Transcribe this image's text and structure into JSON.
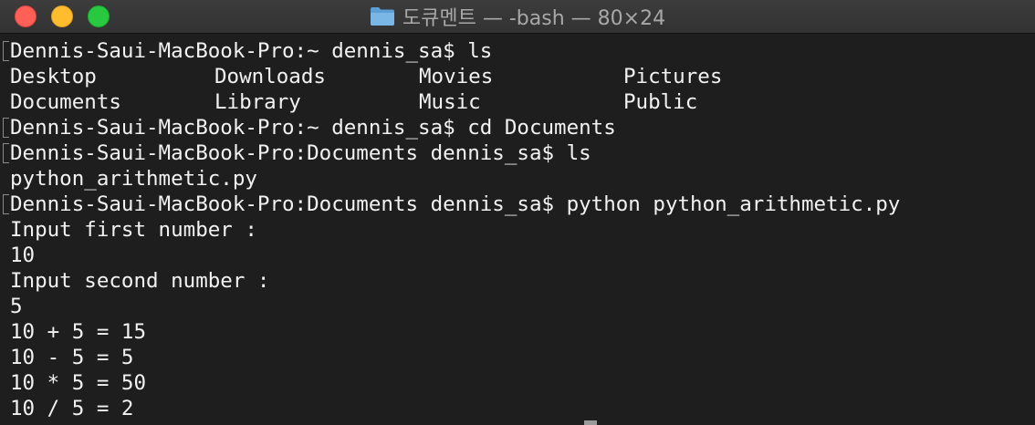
{
  "window": {
    "title": "도큐멘트 — -bash — 80×24",
    "icon": "folder-icon",
    "colors": {
      "background": "#1e1e1e",
      "text": "#f2f2f2",
      "close": "#fe5f57",
      "minimize": "#febc2e",
      "maximize": "#28c840"
    }
  },
  "terminal": {
    "lines": [
      {
        "marked": true,
        "text": "Dennis-Saui-MacBook-Pro:~ dennis_sa$ ls"
      },
      {
        "marked": false,
        "columns": [
          "Desktop",
          "Downloads",
          "Movies",
          "Pictures"
        ]
      },
      {
        "marked": false,
        "columns": [
          "Documents",
          "Library",
          "Music",
          "Public"
        ]
      },
      {
        "marked": true,
        "text": "Dennis-Saui-MacBook-Pro:~ dennis_sa$ cd Documents"
      },
      {
        "marked": true,
        "text": "Dennis-Saui-MacBook-Pro:Documents dennis_sa$ ls"
      },
      {
        "marked": false,
        "text": "python_arithmetic.py"
      },
      {
        "marked": true,
        "text": "Dennis-Saui-MacBook-Pro:Documents dennis_sa$ python python_arithmetic.py"
      },
      {
        "marked": false,
        "text": "Input first number :"
      },
      {
        "marked": false,
        "text": "10"
      },
      {
        "marked": false,
        "text": "Input second number :"
      },
      {
        "marked": false,
        "text": "5"
      },
      {
        "marked": false,
        "text": "10 + 5 = 15"
      },
      {
        "marked": false,
        "text": "10 - 5 = 5"
      },
      {
        "marked": false,
        "text": "10 * 5 = 50"
      },
      {
        "marked": false,
        "text": "10 / 5 = 2"
      }
    ]
  }
}
